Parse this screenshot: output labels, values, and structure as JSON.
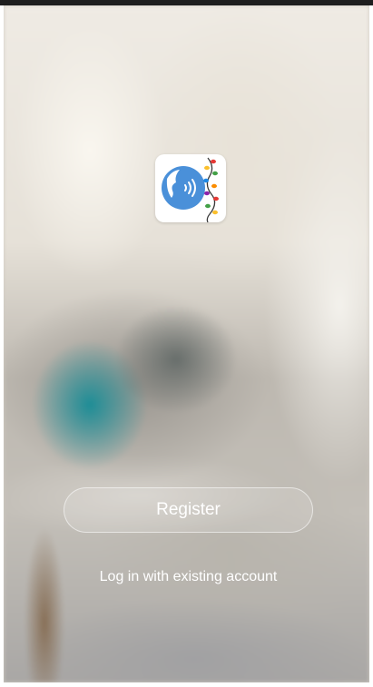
{
  "app": {
    "icon_name": "speaker-face-icon",
    "icon_bg": "#ffffff",
    "icon_accent": "#4a90d9"
  },
  "actions": {
    "register_label": "Register",
    "login_label": "Log in with existing account"
  },
  "colors": {
    "text": "#ffffff",
    "button_border": "rgba(255,255,255,0.55)"
  }
}
